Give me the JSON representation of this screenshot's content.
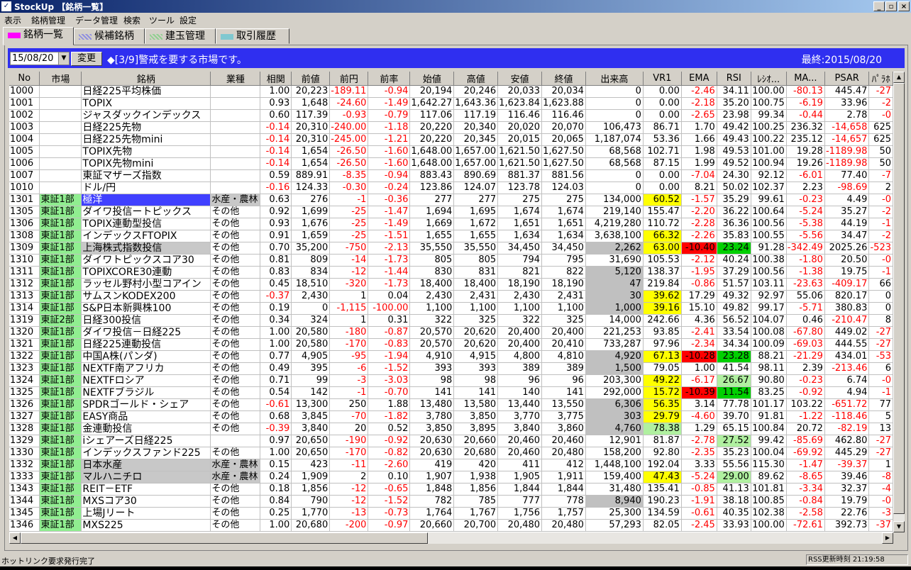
{
  "window": {
    "title": "StockUp 【銘柄一覧】"
  },
  "menu": [
    "表示",
    "銘柄管理",
    "データ管理",
    "検索",
    "ツール",
    "設定"
  ],
  "tabs": [
    {
      "label": "銘柄一覧",
      "color": "#ff00ff"
    },
    {
      "label": "候補銘柄",
      "color": "#9090e0"
    },
    {
      "label": "建玉管理",
      "color": "#90d090"
    },
    {
      "label": "取引履歴",
      "color": "#80c8d0"
    }
  ],
  "infobar": {
    "date_value": "15/08/20",
    "change_label": "変更",
    "alert": "◆[3/9]警戒を要する市場です。",
    "last_update": "最終:2015/08/20"
  },
  "columns": [
    "No",
    "市場",
    "銘柄",
    "業種",
    "相関",
    "前値",
    "前円",
    "前率",
    "始値",
    "高値",
    "安値",
    "終値",
    "出来高",
    "VR1",
    "EMA",
    "RSI",
    "ﾚｼｵ...",
    "MA...",
    "PSAR",
    "ﾊﾟﾗﾎ"
  ],
  "rows": [
    [
      "1000",
      "",
      "日経225平均株価",
      "",
      "1.00",
      "20,223",
      "-189.11",
      "-0.94",
      "20,194",
      "20,246",
      "20,033",
      "20,034",
      "0",
      "0.00",
      "-2.46",
      "34.11",
      "100.00",
      "-80.13",
      "445.47",
      "-27"
    ],
    [
      "1001",
      "",
      "TOPIX",
      "",
      "0.93",
      "1,648",
      "-24.60",
      "-1.49",
      "1,642.27",
      "1,643.36",
      "1,623.84",
      "1,623.88",
      "0",
      "0.00",
      "-2.18",
      "35.20",
      "100.75",
      "-6.19",
      "33.96",
      "-2"
    ],
    [
      "1002",
      "",
      "ジャスダックインデックス",
      "",
      "0.60",
      "117.39",
      "-0.93",
      "-0.79",
      "117.06",
      "117.19",
      "116.46",
      "116.46",
      "0",
      "0.00",
      "-2.65",
      "23.98",
      "99.34",
      "-0.44",
      "2.78",
      "-0"
    ],
    [
      "1003",
      "",
      "日経225先物",
      "",
      "-0.14",
      "20,310",
      "-240.00",
      "-1.18",
      "20,220",
      "20,340",
      "20,020",
      "20,070",
      "106,473",
      "86.71",
      "1.70",
      "49.42",
      "100.25",
      "236.32",
      "-14,658",
      "625"
    ],
    [
      "1004",
      "",
      "日経225先物mini",
      "",
      "-0.14",
      "20,310",
      "-245.00",
      "-1.21",
      "20,220",
      "20,345",
      "20,015",
      "20,065",
      "1,187,074",
      "53.36",
      "1.66",
      "49.43",
      "100.22",
      "235.12",
      "-14,657",
      "625"
    ],
    [
      "1005",
      "",
      "TOPIX先物",
      "",
      "-0.14",
      "1,654",
      "-26.50",
      "-1.60",
      "1,648.00",
      "1,657.00",
      "1,621.50",
      "1,627.50",
      "68,568",
      "102.71",
      "1.98",
      "49.53",
      "101.00",
      "19.28",
      "-1189.98",
      "50"
    ],
    [
      "1006",
      "",
      "TOPIX先物mini",
      "",
      "-0.14",
      "1,654",
      "-26.50",
      "-1.60",
      "1,648.00",
      "1,657.00",
      "1,621.50",
      "1,627.50",
      "68,568",
      "87.15",
      "1.99",
      "49.52",
      "100.94",
      "19.26",
      "-1189.98",
      "50"
    ],
    [
      "1007",
      "",
      "東証マザーズ指数",
      "",
      "0.59",
      "889.91",
      "-8.35",
      "-0.94",
      "883.43",
      "890.69",
      "881.37",
      "881.56",
      "0",
      "0.00",
      "-7.04",
      "24.30",
      "92.12",
      "-6.01",
      "77.40",
      "-7"
    ],
    [
      "1010",
      "",
      "ドル/円",
      "",
      "-0.16",
      "124.33",
      "-0.30",
      "-0.24",
      "123.86",
      "124.07",
      "123.78",
      "124.03",
      "0",
      "0.00",
      "8.21",
      "50.02",
      "102.37",
      "2.23",
      "-98.69",
      "2"
    ],
    [
      "1301",
      "東証1部",
      "極洋",
      "水産・農林",
      "0.63",
      "276",
      "-1",
      "-0.36",
      "277",
      "277",
      "275",
      "275",
      "134,000",
      "60.52",
      "-1.57",
      "35.29",
      "99.61",
      "-0.23",
      "4.49",
      "-0"
    ],
    [
      "1305",
      "東証1部",
      "ダイワ投信ートピックス",
      "その他",
      "0.92",
      "1,699",
      "-25",
      "-1.47",
      "1,694",
      "1,695",
      "1,674",
      "1,674",
      "219,140",
      "155.47",
      "-2.20",
      "36.22",
      "100.64",
      "-5.24",
      "35.27",
      "-2"
    ],
    [
      "1306",
      "東証1部",
      "TOPIX連動型投信",
      "その他",
      "0.93",
      "1,676",
      "-25",
      "-1.49",
      "1,669",
      "1,672",
      "1,651",
      "1,651",
      "4,219,280",
      "110.72",
      "-2.28",
      "36.36",
      "100.56",
      "-5.38",
      "44.19",
      "-1"
    ],
    [
      "1308",
      "東証1部",
      "インデックスFTOPIX",
      "その他",
      "0.91",
      "1,659",
      "-25",
      "-1.51",
      "1,655",
      "1,655",
      "1,634",
      "1,634",
      "3,638,100",
      "66.32",
      "-2.26",
      "35.83",
      "100.55",
      "-5.56",
      "34.47",
      "-2"
    ],
    [
      "1309",
      "東証1部",
      "上海株式指数投信",
      "その他",
      "0.70",
      "35,200",
      "-750",
      "-2.13",
      "35,550",
      "35,550",
      "34,450",
      "34,450",
      "2,262",
      "63.00",
      "-10.40",
      "23.24",
      "91.28",
      "-342.49",
      "2025.26",
      "-523"
    ],
    [
      "1310",
      "東証1部",
      "ダイワトピックスコア30",
      "その他",
      "0.81",
      "809",
      "-14",
      "-1.73",
      "805",
      "805",
      "794",
      "795",
      "31,690",
      "105.53",
      "-2.12",
      "40.24",
      "100.38",
      "-1.80",
      "20.50",
      "-0"
    ],
    [
      "1311",
      "東証1部",
      "TOPIXCORE30連動",
      "その他",
      "0.83",
      "834",
      "-12",
      "-1.44",
      "830",
      "831",
      "821",
      "822",
      "5,120",
      "138.37",
      "-1.95",
      "37.29",
      "100.56",
      "-1.38",
      "19.75",
      "-1"
    ],
    [
      "1312",
      "東証1部",
      "ラッセル野村小型コアイン",
      "その他",
      "0.45",
      "18,510",
      "-320",
      "-1.73",
      "18,400",
      "18,400",
      "18,190",
      "18,190",
      "47",
      "219.84",
      "-0.86",
      "51.57",
      "103.11",
      "-23.63",
      "-409.17",
      "66"
    ],
    [
      "1313",
      "東証1部",
      "サムスンKODEX200",
      "その他",
      "-0.37",
      "2,430",
      "1",
      "0.04",
      "2,430",
      "2,431",
      "2,430",
      "2,431",
      "30",
      "39.62",
      "17.29",
      "49.32",
      "92.97",
      "55.06",
      "820.17",
      "0"
    ],
    [
      "1314",
      "東証1部",
      "S&P日本新興株100",
      "その他",
      "0.19",
      "0",
      "-1,115",
      "-100.00",
      "1,100",
      "1,100",
      "1,100",
      "1,100",
      "1,000",
      "39.16",
      "15.10",
      "49.82",
      "99.17",
      "-5.71",
      "380.83",
      "0"
    ],
    [
      "1319",
      "東証2部",
      "日経300投信",
      "その他",
      "0.34",
      "324",
      "1",
      "0.31",
      "322",
      "325",
      "322",
      "325",
      "14,000",
      "242.66",
      "4.36",
      "56.52",
      "104.07",
      "0.46",
      "-210.47",
      "8"
    ],
    [
      "1320",
      "東証1部",
      "ダイワ投信－日経225",
      "その他",
      "1.00",
      "20,580",
      "-180",
      "-0.87",
      "20,570",
      "20,620",
      "20,400",
      "20,400",
      "221,253",
      "93.85",
      "-2.41",
      "33.54",
      "100.08",
      "-67.80",
      "449.02",
      "-27"
    ],
    [
      "1321",
      "東証1部",
      "日経225連動投信",
      "その他",
      "1.00",
      "20,580",
      "-170",
      "-0.83",
      "20,570",
      "20,620",
      "20,400",
      "20,410",
      "733,287",
      "97.96",
      "-2.34",
      "34.34",
      "100.09",
      "-69.03",
      "444.55",
      "-27"
    ],
    [
      "1322",
      "東証1部",
      "中国A株(パンダ)",
      "その他",
      "0.77",
      "4,905",
      "-95",
      "-1.94",
      "4,910",
      "4,915",
      "4,800",
      "4,810",
      "4,920",
      "67.13",
      "-10.28",
      "23.28",
      "88.21",
      "-21.29",
      "434.01",
      "-53"
    ],
    [
      "1323",
      "東証1部",
      "NEXTF南アフリカ",
      "その他",
      "0.49",
      "395",
      "-6",
      "-1.52",
      "393",
      "393",
      "389",
      "389",
      "1,500",
      "79.05",
      "1.00",
      "41.54",
      "98.11",
      "2.39",
      "-213.46",
      "6"
    ],
    [
      "1324",
      "東証1部",
      "NEXTFロシア",
      "その他",
      "0.71",
      "99",
      "-3",
      "-3.03",
      "98",
      "98",
      "96",
      "96",
      "203,300",
      "49.22",
      "-6.17",
      "26.67",
      "90.80",
      "-0.23",
      "6.74",
      "-0"
    ],
    [
      "1325",
      "東証1部",
      "NEXTFブラジル",
      "その他",
      "0.54",
      "142",
      "-1",
      "-0.70",
      "141",
      "141",
      "140",
      "141",
      "292,000",
      "15.72",
      "-10.39",
      "11.54",
      "83.25",
      "-0.92",
      "4.94",
      "-1"
    ],
    [
      "1326",
      "東証1部",
      "SPDRゴールド・シェア",
      "その他",
      "-0.61",
      "13,300",
      "250",
      "1.88",
      "13,480",
      "13,580",
      "13,440",
      "13,550",
      "6,306",
      "56.35",
      "3.14",
      "77.78",
      "101.17",
      "103.22",
      "-651.72",
      "77"
    ],
    [
      "1327",
      "東証1部",
      "EASY商品",
      "その他",
      "0.68",
      "3,845",
      "-70",
      "-1.82",
      "3,780",
      "3,850",
      "3,770",
      "3,775",
      "303",
      "29.79",
      "-4.60",
      "39.70",
      "91.81",
      "-1.22",
      "-118.46",
      "5"
    ],
    [
      "1328",
      "東証1部",
      "金連動投信",
      "その他",
      "-0.39",
      "3,840",
      "20",
      "0.52",
      "3,850",
      "3,895",
      "3,840",
      "3,860",
      "4,760",
      "78.38",
      "1.29",
      "65.15",
      "100.84",
      "20.72",
      "-82.19",
      "13"
    ],
    [
      "1329",
      "東証1部",
      "iシェアーズ日経225",
      "",
      "0.97",
      "20,650",
      "-190",
      "-0.92",
      "20,630",
      "20,660",
      "20,460",
      "20,460",
      "12,901",
      "81.87",
      "-2.78",
      "27.52",
      "99.42",
      "-85.69",
      "462.80",
      "-27"
    ],
    [
      "1330",
      "東証1部",
      "インデックスファンド225",
      "その他",
      "1.00",
      "20,650",
      "-170",
      "-0.82",
      "20,630",
      "20,680",
      "20,460",
      "20,480",
      "158,200",
      "92.80",
      "-2.35",
      "35.23",
      "100.04",
      "-69.92",
      "445.29",
      "-27"
    ],
    [
      "1332",
      "東証1部",
      "日本水産",
      "水産・農林",
      "0.15",
      "423",
      "-11",
      "-2.60",
      "419",
      "420",
      "411",
      "412",
      "1,448,100",
      "192.04",
      "3.33",
      "55.56",
      "115.30",
      "-1.47",
      "-39.37",
      "1"
    ],
    [
      "1333",
      "東証1部",
      "マルハニチロ",
      "水産・農林",
      "0.24",
      "1,909",
      "2",
      "0.10",
      "1,907",
      "1,938",
      "1,905",
      "1,911",
      "159,400",
      "47.43",
      "-5.24",
      "29.00",
      "89.62",
      "-8.65",
      "39.46",
      "-8"
    ],
    [
      "1343",
      "東証1部",
      "REIT－ETF",
      "その他",
      "0.18",
      "1,856",
      "-12",
      "-0.65",
      "1,848",
      "1,856",
      "1,844",
      "1,844",
      "31,480",
      "135.41",
      "-0.85",
      "41.13",
      "101.81",
      "-3.34",
      "32.37",
      "-4"
    ],
    [
      "1344",
      "東証1部",
      "MXSコア30",
      "その他",
      "0.84",
      "790",
      "-12",
      "-1.52",
      "782",
      "785",
      "777",
      "778",
      "8,940",
      "190.23",
      "-1.91",
      "38.18",
      "100.85",
      "-0.84",
      "19.79",
      "-0"
    ],
    [
      "1345",
      "東証1部",
      "上場Jリート",
      "その他",
      "0.25",
      "1,770",
      "-13",
      "-0.73",
      "1,764",
      "1,767",
      "1,756",
      "1,757",
      "25,300",
      "134.59",
      "-0.61",
      "40.35",
      "102.38",
      "-2.58",
      "22.76",
      "-3"
    ],
    [
      "1346",
      "東証1部",
      "MXS225",
      "その他",
      "1.00",
      "20,680",
      "-200",
      "-0.97",
      "20,660",
      "20,700",
      "20,480",
      "20,480",
      "57,293",
      "82.05",
      "-2.45",
      "33.93",
      "100.00",
      "-72.61",
      "392.73",
      "-37"
    ]
  ],
  "status": {
    "left": "ホットリンク要求発行完了",
    "right": "RSS更新時刻 21:19:58"
  },
  "colors": {
    "infobar": "#2f2ff0",
    "market_green": "#90ee90",
    "negative": "#ff0000",
    "highlight_yellow": "#ffff00",
    "highlight_green": "#00d000",
    "highlight_grey": "#c0c0c0"
  }
}
